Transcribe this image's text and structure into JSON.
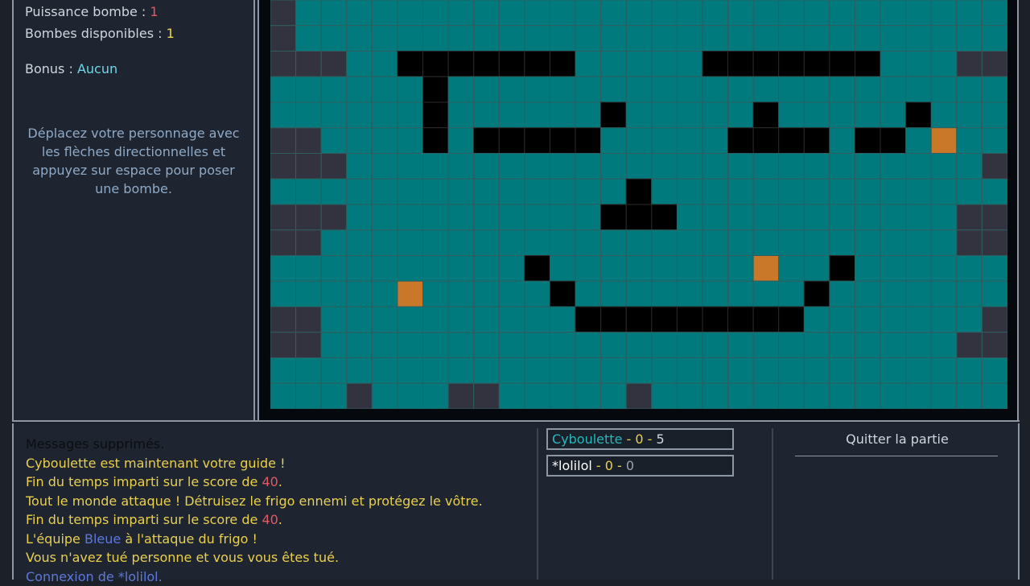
{
  "sidebar": {
    "bomb_power_label": "Puissance bombe : ",
    "bomb_power_value": "1",
    "bombs_available_label": "Bombes disponibles : ",
    "bombs_available_value": "1",
    "bonus_label": "Bonus : ",
    "bonus_value": "Aucun",
    "help_text": "Déplacez votre personnage avec les flèches directionnelles et appuyez sur espace pour poser une bombe."
  },
  "colors": {
    "floor": "#007a7c",
    "floor_line": "#2e5e60",
    "wall_black": "#000000",
    "crate_orange": "#c87828",
    "border_slate": "#33323f"
  },
  "board": {
    "cols": 29,
    "rows": 16,
    "note_rows_legend": "c=floor, #=black wall, o=crate, s=border slate",
    "map": [
      "sccccccccccccccccccccccccccccs",
      "sccccccccccccccccccccccccccccs",
      "ssscc#######ccccc#######cccsss",
      "cccccc#cccccccccccccccccccccc",
      "cccccc#cccccc#ccccc#ccccc#ccc",
      "sscccc#c#####ccccc####c##coccs",
      "ssscccccccccccccccccccccccccss",
      "cccccccccccccc#cccccccccccccc",
      "ssscccccccccc###cccccccccccss",
      "sscccccccccccccccccccccccccss",
      "cccccccccc#ccccccccocc#ccccccc",
      "cccccoccccc#ccccccccc#ccccccc",
      "sscccccccccc#########cccccccss",
      "sscccccccccccccccccccccccccss",
      "ccccccccccccccccccccccccccccc",
      "cccscccsscccccsccccccccccccc"
    ]
  },
  "messages": [
    {
      "text": "Messages supprimés.",
      "style": "dim"
    },
    {
      "text": "Cyboulette est maintenant votre guide !",
      "style": "normal"
    },
    {
      "prefix": "Fin du temps imparti sur le score de ",
      "highlight": "40",
      "suffix": ".",
      "style": "normal",
      "hl": "red"
    },
    {
      "text": "Tout le monde attaque ! Détruisez le frigo ennemi et protégez le vôtre.",
      "style": "normal"
    },
    {
      "prefix": "Fin du temps imparti sur le score de ",
      "highlight": "40",
      "suffix": ".",
      "style": "normal",
      "hl": "red"
    },
    {
      "prefix": "L'équipe ",
      "highlight": "Bleue",
      "suffix": " à l'attaque du frigo !",
      "style": "normal",
      "hl": "blue"
    },
    {
      "text": "Vous n'avez tué personne et vous vous êtes tué.",
      "style": "normal"
    },
    {
      "text": "Connexion de *lolilol.",
      "style": "blue"
    }
  ],
  "scores": [
    {
      "name": "Cyboulette",
      "sep1": " - ",
      "kills": "0",
      "sep2": " - ",
      "deaths": "5"
    },
    {
      "name": "*lolilol",
      "sep1": " - ",
      "kills": "0",
      "sep2": " - ",
      "deaths": "0"
    }
  ],
  "quit_label": "Quitter la partie"
}
